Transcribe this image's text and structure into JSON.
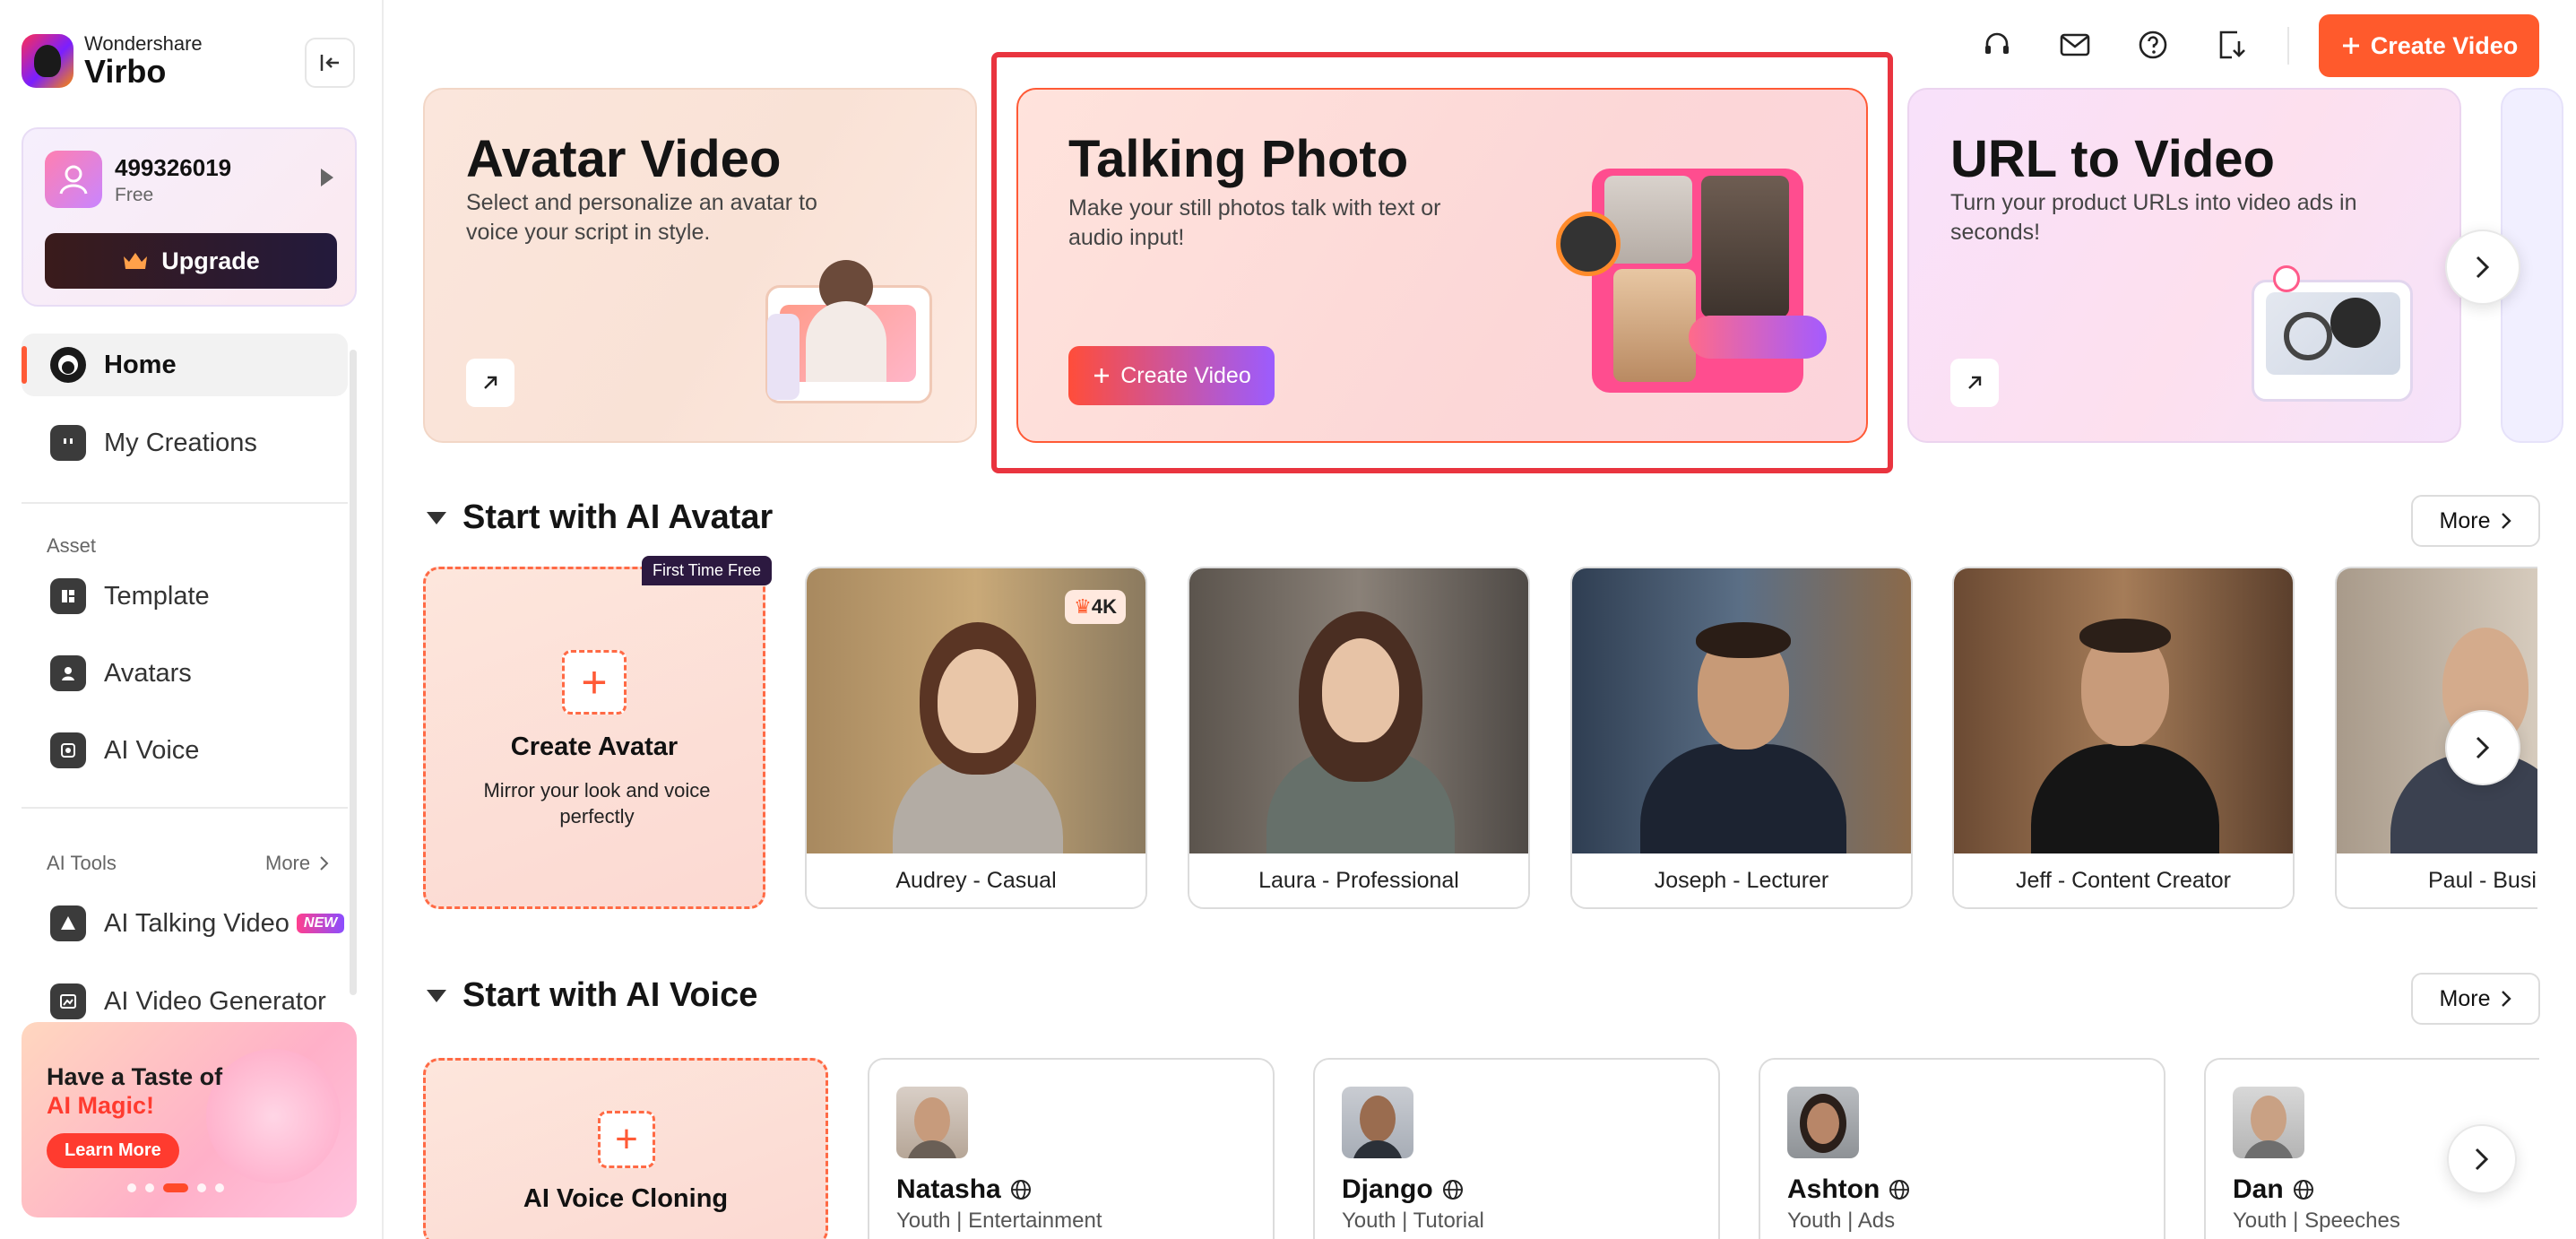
{
  "brand": {
    "company": "Wondershare",
    "product": "Virbo"
  },
  "account": {
    "id": "499326019",
    "plan": "Free",
    "upgrade_label": "Upgrade"
  },
  "nav": {
    "home": "Home",
    "my_creations": "My Creations",
    "asset_label": "Asset",
    "template": "Template",
    "avatars": "Avatars",
    "ai_voice": "AI Voice",
    "ai_tools_label": "AI Tools",
    "ai_tools_more": "More",
    "ai_talking_video": "AI Talking Video",
    "new_badge": "NEW",
    "ai_video_generator": "AI Video Generator"
  },
  "promo": {
    "line1": "Have a Taste of",
    "line2": "AI Magic!",
    "button": "Learn More"
  },
  "topbar": {
    "icons": [
      "headset-icon",
      "mail-icon",
      "help-icon",
      "download-icon"
    ],
    "create_video": "Create Video"
  },
  "features": {
    "avatar_video": {
      "title": "Avatar Video",
      "desc": "Select and personalize an avatar to voice your script in style."
    },
    "talking_photo": {
      "title": "Talking Photo",
      "desc": "Make your still photos talk with text or audio input!",
      "button": "Create Video"
    },
    "url_to_video": {
      "title": "URL to Video",
      "desc": "Turn your product URLs into video ads in seconds!"
    }
  },
  "ai_avatar_section": {
    "title": "Start with AI Avatar",
    "more": "More",
    "create": {
      "badge": "First Time Free",
      "title": "Create Avatar",
      "desc": "Mirror your look and voice perfectly"
    },
    "badge_4k": "4K",
    "avatars": [
      {
        "name": "Audrey - Casual"
      },
      {
        "name": "Laura - Professional"
      },
      {
        "name": "Joseph - Lecturer"
      },
      {
        "name": "Jeff - Content Creator"
      },
      {
        "name": "Paul - Busi"
      }
    ]
  },
  "ai_voice_section": {
    "title": "Start with AI Voice",
    "more": "More",
    "create": {
      "title": "AI Voice Cloning"
    },
    "voices": [
      {
        "name": "Natasha",
        "meta": "Youth | Entertainment"
      },
      {
        "name": "Django",
        "meta": "Youth | Tutorial"
      },
      {
        "name": "Ashton",
        "meta": "Youth | Ads"
      },
      {
        "name": "Dan",
        "meta": "Youth | Speeches"
      }
    ]
  },
  "colors": {
    "accent": "#ff5a2c",
    "highlight": "#e9343f",
    "dark": "#141414"
  }
}
